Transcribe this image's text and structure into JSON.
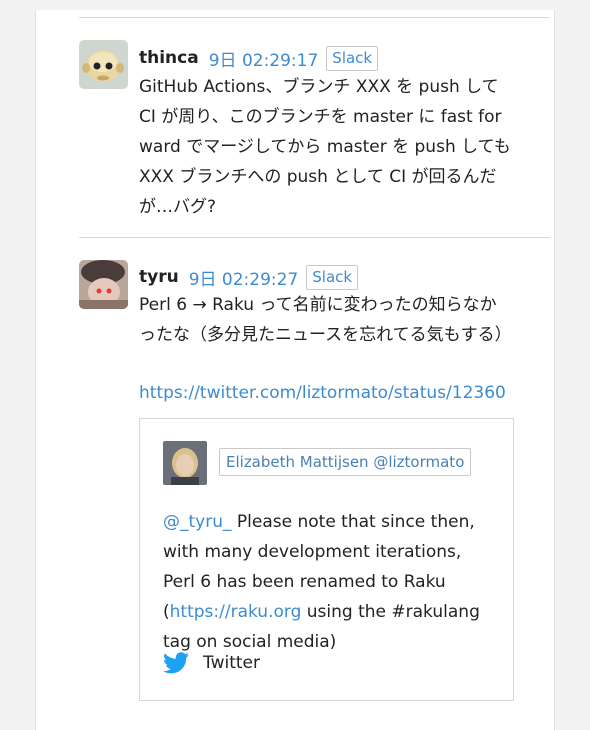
{
  "messages": [
    {
      "username": "thinca",
      "timestamp": "9日 02:29:17",
      "source": "Slack",
      "avatar_icon": "ghost-avatar-icon",
      "body": "GitHub Actions、ブランチ XXX を push して CI が周り、このブランチを master に fast forward でマージしてから master を push しても XXX ブランチへの push として CI が回るんだが…バグ?"
    },
    {
      "username": "tyru",
      "timestamp": "9日 02:29:27",
      "source": "Slack",
      "avatar_icon": "person-photo-avatar-icon",
      "body": "Perl 6 → Raku って名前に変わったの知らなかったな（多分見たニュースを忘れてる気もする）",
      "link": "https://twitter.com/liztormato/status/12360",
      "embed": {
        "author": "Elizabeth Mattijsen @liztormato",
        "mention": "@_tyru_",
        "text_part1": " Please note that since then, with many development iterations, Perl 6 has been renamed to Raku (",
        "link_text": "https://raku.org",
        "text_part2": " using the #rakulang tag on social media)",
        "footer_label": "Twitter",
        "footer_icon": "twitter-bird-icon"
      }
    }
  ],
  "colors": {
    "link": "#3d8bd0",
    "twitter_blue": "#1da1f2",
    "divider": "#d9d9d9"
  }
}
